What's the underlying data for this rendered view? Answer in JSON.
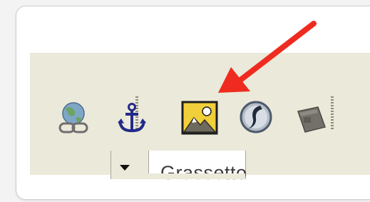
{
  "toolbar": {
    "buttons": [
      {
        "name": "link",
        "icon": "globe-link-icon"
      },
      {
        "name": "anchor",
        "icon": "anchor-icon"
      },
      {
        "name": "image",
        "icon": "image-icon",
        "highlighted": true
      },
      {
        "name": "flash",
        "icon": "flash-icon"
      },
      {
        "name": "media",
        "icon": "media-icon"
      }
    ]
  },
  "style_combo": {
    "value": "Grassetto"
  },
  "annotation": {
    "arrow_color": "#ef2b1f",
    "points_to": "image-button"
  }
}
